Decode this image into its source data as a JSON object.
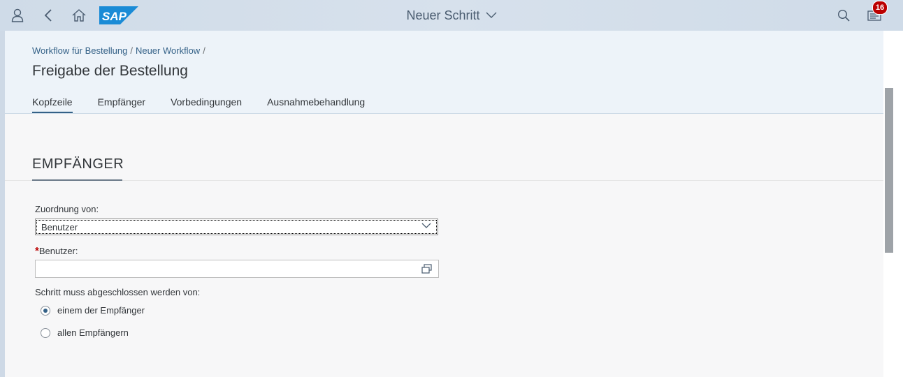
{
  "shell": {
    "title": "Neuer Schritt",
    "logo_text": "SAP",
    "notification_count": "16",
    "icons": [
      "user-icon",
      "back-icon",
      "home-icon",
      "search-icon",
      "notifications-icon"
    ],
    "colors": {
      "logo": "#1a8bd6",
      "badge": "#bb0000"
    }
  },
  "breadcrumb": {
    "items": [
      "Workflow für Bestellung",
      "Neuer Workflow"
    ],
    "separator": "/"
  },
  "page": {
    "title": "Freigabe der Bestellung"
  },
  "tabs": [
    {
      "label": "Kopfzeile",
      "active": true
    },
    {
      "label": "Empfänger",
      "active": false
    },
    {
      "label": "Vorbedingungen",
      "active": false
    },
    {
      "label": "Ausnahmebehandlung",
      "active": false
    }
  ],
  "section": {
    "title": "EMPFÄNGER"
  },
  "form": {
    "assignment_label": "Zuordnung von:",
    "assignment_value": "Benutzer",
    "user_required_marker": "*",
    "user_label": "Benutzer:",
    "user_value": "",
    "completion_label": "Schritt muss abgeschlossen werden von:",
    "options": [
      {
        "label": "einem der Empfänger",
        "selected": true
      },
      {
        "label": "allen Empfängern",
        "selected": false
      }
    ]
  }
}
